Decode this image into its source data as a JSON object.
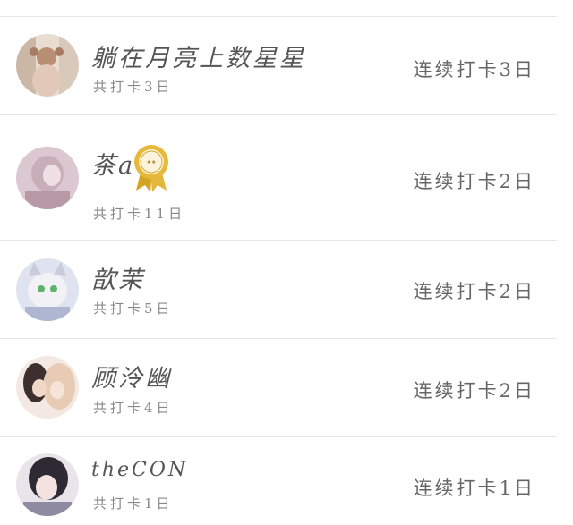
{
  "list": {
    "rows": [
      {
        "name": "躺在月亮上数星星",
        "total": "共打卡3日",
        "streak": "连续打卡3日",
        "avatar_icon": "avatar-girl-with-bear",
        "avatar_color": "#d8c3b5"
      },
      {
        "name": "茶a",
        "total": "共打卡11日",
        "streak": "连续打卡2日",
        "avatar_icon": "avatar-pink-portrait",
        "avatar_color": "#d7c0c8",
        "badge_icon": "gold-medal-ribbon-icon"
      },
      {
        "name": "歆茉",
        "total": "共打卡5日",
        "streak": "连续打卡2日",
        "avatar_icon": "avatar-anime-cat",
        "avatar_color": "#cfd4e6"
      },
      {
        "name": "顾泠幽",
        "total": "共打卡4日",
        "streak": "连续打卡2日",
        "avatar_icon": "avatar-anime-couple",
        "avatar_color": "#e8d6cc"
      },
      {
        "name": "theCON",
        "total": "共打卡1日",
        "streak": "连续打卡1日",
        "avatar_icon": "avatar-anime-girl-dark-hair",
        "avatar_color": "#d9d5dc"
      }
    ]
  }
}
